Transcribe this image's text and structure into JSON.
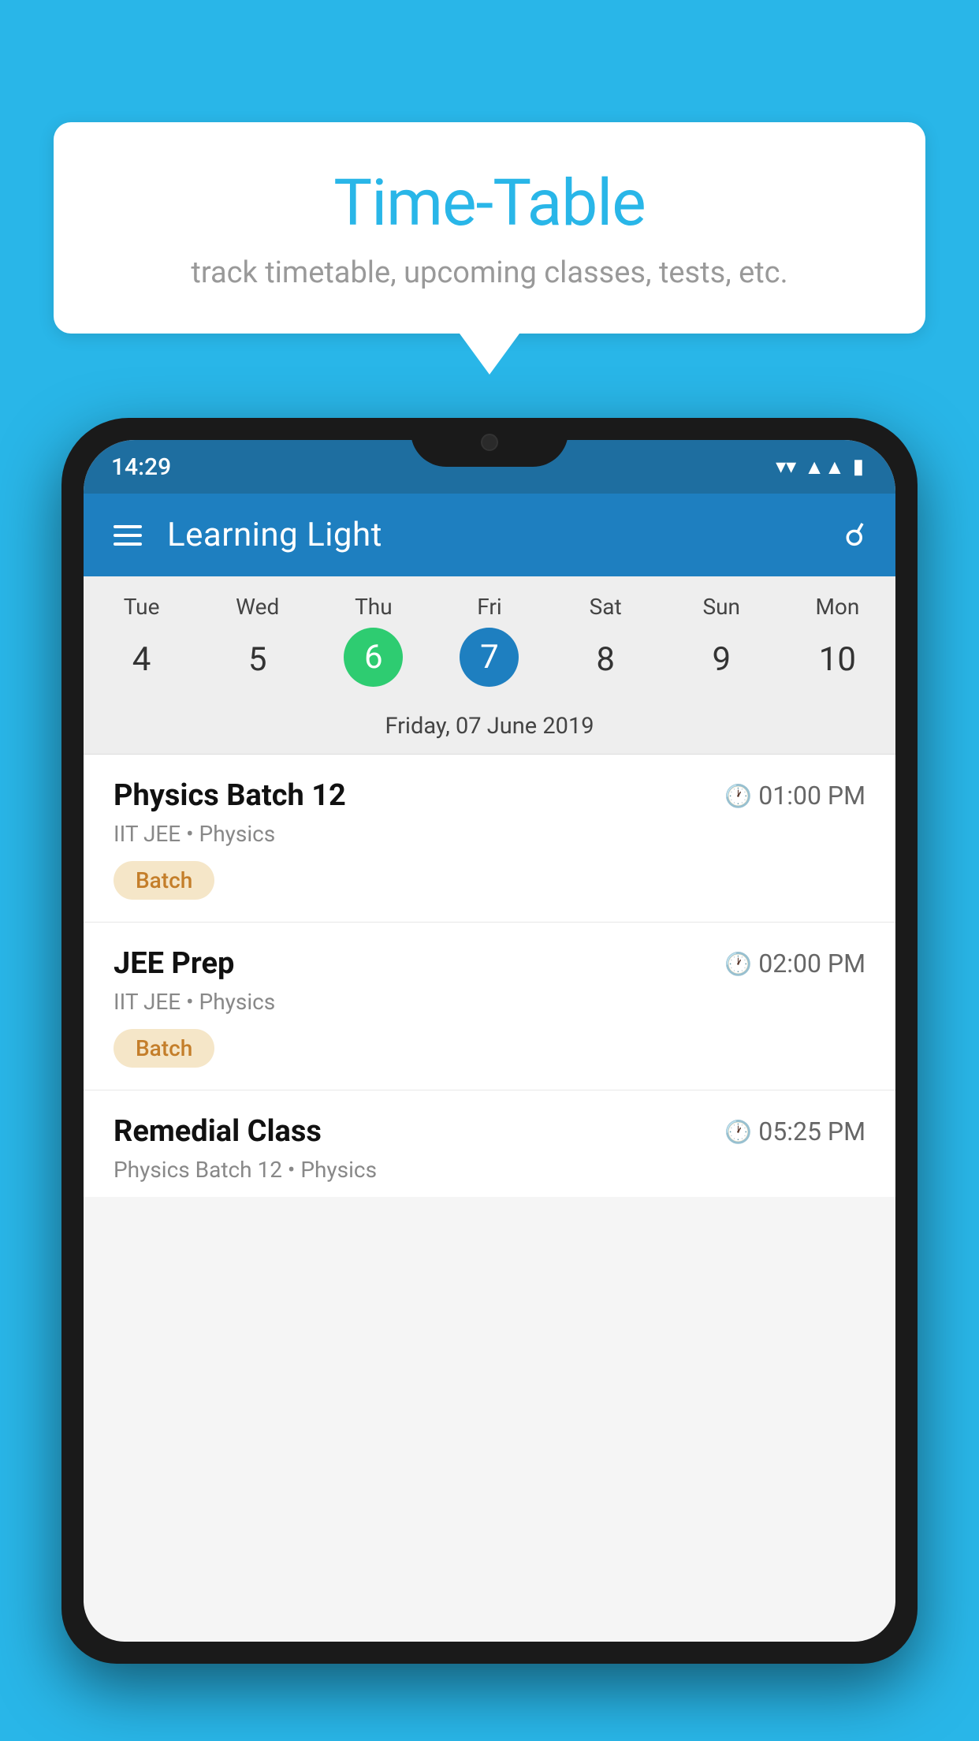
{
  "background_color": "#29b6e8",
  "hero": {
    "title": "Time-Table",
    "subtitle": "track timetable, upcoming classes, tests, etc."
  },
  "phone": {
    "status_bar": {
      "time": "14:29",
      "icons": [
        "wifi",
        "signal",
        "battery"
      ]
    },
    "app_bar": {
      "title": "Learning Light"
    },
    "calendar": {
      "day_labels": [
        "Tue",
        "Wed",
        "Thu",
        "Fri",
        "Sat",
        "Sun",
        "Mon"
      ],
      "day_numbers": [
        "4",
        "5",
        "6",
        "7",
        "8",
        "9",
        "10"
      ],
      "today_index": 2,
      "selected_index": 3,
      "selected_date_label": "Friday, 07 June 2019"
    },
    "events": [
      {
        "name": "Physics Batch 12",
        "time": "01:00 PM",
        "sub": "IIT JEE • Physics",
        "badge": "Batch"
      },
      {
        "name": "JEE Prep",
        "time": "02:00 PM",
        "sub": "IIT JEE • Physics",
        "badge": "Batch"
      },
      {
        "name": "Remedial Class",
        "time": "05:25 PM",
        "sub": "Physics Batch 12 • Physics",
        "badge": null
      }
    ]
  }
}
